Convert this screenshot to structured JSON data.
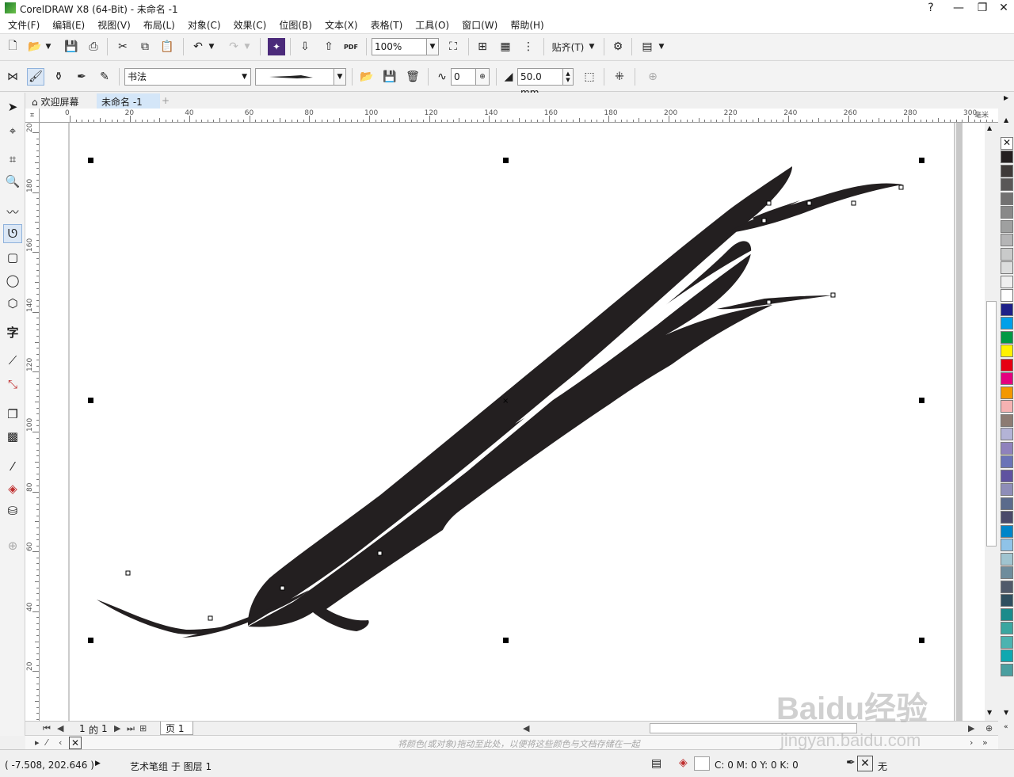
{
  "window": {
    "title": "CorelDRAW X8 (64-Bit) - 未命名 -1",
    "buttons": {
      "help": "?",
      "minimize": "—",
      "restore": "❐",
      "close": "✕"
    }
  },
  "menu": [
    "文件(F)",
    "编辑(E)",
    "视图(V)",
    "布局(L)",
    "对象(C)",
    "效果(C)",
    "位图(B)",
    "文本(X)",
    "表格(T)",
    "工具(O)",
    "窗口(W)",
    "帮助(H)"
  ],
  "standard_toolbar": {
    "zoom_value": "100%",
    "snap_label": "贴齐(T)",
    "pdf_label": "PDF"
  },
  "property_bar": {
    "artistic_media_type": "书法",
    "smoothness_value": "0",
    "width_value": "50.0 mm"
  },
  "tabs": [
    {
      "label": "欢迎屏幕",
      "icon": "home-icon"
    },
    {
      "label": "未命名 -1",
      "active": true
    }
  ],
  "rulers": {
    "unit_label": "毫米",
    "h_ticks": [
      "0",
      "20",
      "40",
      "60",
      "80",
      "100",
      "120",
      "140",
      "160",
      "180",
      "200",
      "220",
      "240",
      "260",
      "280",
      "300"
    ],
    "v_ticks": [
      "200",
      "180",
      "160",
      "140",
      "120",
      "100",
      "80",
      "60",
      "40",
      "20"
    ]
  },
  "page_nav": {
    "current": "1",
    "of": "的",
    "total": "1",
    "page_tab": "页 1"
  },
  "doc_palette_hint": "将颜色(或对象)拖动至此处，以便将这些颜色与文档存储在一起",
  "status": {
    "coords": "( -7.508, 202.646 )",
    "object_info": "艺术笔组 于 图层 1",
    "fill_info": "C: 0 M: 0 Y: 0 K: 0",
    "outline_info": "无"
  },
  "palette_colors": [
    "#231f20",
    "#3e3a39",
    "#595757",
    "#727171",
    "#898989",
    "#9fa0a0",
    "#b5b5b6",
    "#c9caca",
    "#dcdddd",
    "#efefef",
    "#ffffff",
    "#1d2088",
    "#00a0e9",
    "#009944",
    "#fff100",
    "#e60012",
    "#e4007f",
    "#f39800",
    "#f5b2b2",
    "#8c7b73",
    "#b3b3d6",
    "#8f82bc",
    "#6a73b7",
    "#5f52a0",
    "#8e8db8",
    "#5b6b8c",
    "#4a4a6a",
    "#0085c9",
    "#8fc3e8",
    "#a0c4d0",
    "#6e8c9c",
    "#505a6a",
    "#2f4f5f",
    "#1a8b8b",
    "#3aa6a0",
    "#4cb3b0",
    "#0fa8b0",
    "#4a9fa0"
  ],
  "watermark": {
    "brand": "Baidu经验",
    "url": "jingyan.baidu.com"
  }
}
